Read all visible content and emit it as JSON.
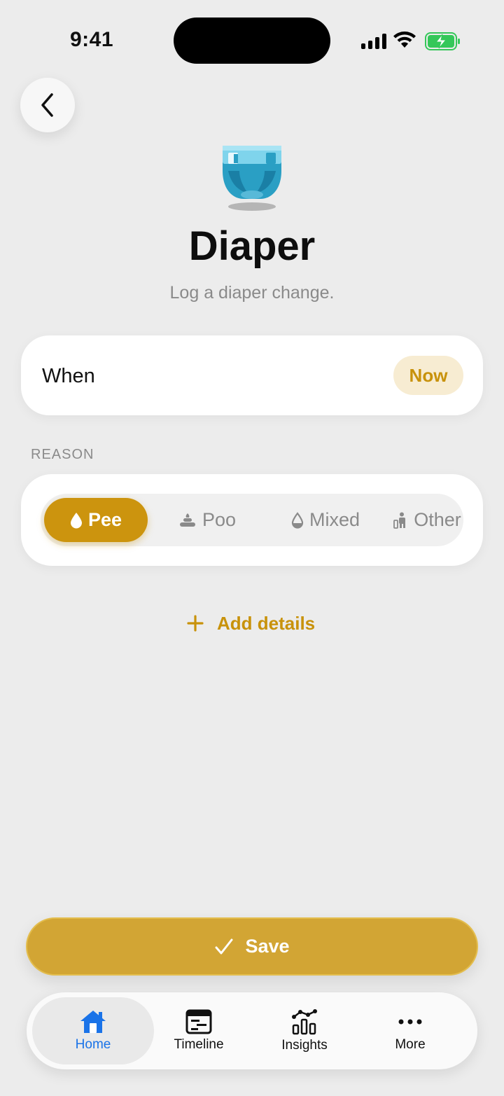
{
  "status_bar": {
    "time": "9:41"
  },
  "header": {
    "back_icon": "chevron-left-icon",
    "hero_icon": "diaper-icon",
    "title": "Diaper",
    "subtitle": "Log a diaper change."
  },
  "when": {
    "label": "When",
    "value": "Now"
  },
  "reason": {
    "section_label": "REASON",
    "options": [
      {
        "label": "Pee",
        "icon": "droplet-icon",
        "selected": true
      },
      {
        "label": "Poo",
        "icon": "poo-icon",
        "selected": false
      },
      {
        "label": "Mixed",
        "icon": "droplet-outline-icon",
        "selected": false
      },
      {
        "label": "Other",
        "icon": "person-icon",
        "selected": false
      }
    ]
  },
  "add_details": {
    "label": "Add details"
  },
  "save": {
    "label": "Save"
  },
  "tabs": [
    {
      "label": "Home",
      "icon": "home-icon",
      "active": true
    },
    {
      "label": "Timeline",
      "icon": "timeline-icon",
      "active": false
    },
    {
      "label": "Insights",
      "icon": "insights-icon",
      "active": false
    },
    {
      "label": "More",
      "icon": "more-icon",
      "active": false
    }
  ],
  "colors": {
    "accent": "#cc940e",
    "accent_light": "#f7ecd2",
    "save_button": "#d2a534",
    "tab_active": "#1a73e8",
    "background": "#ececec"
  }
}
